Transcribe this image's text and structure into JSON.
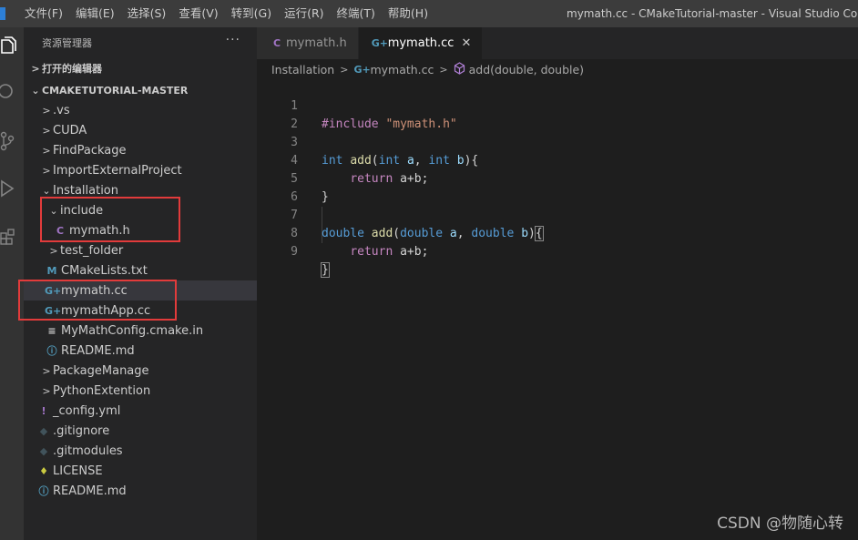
{
  "menu": [
    "文件(F)",
    "编辑(E)",
    "选择(S)",
    "查看(V)",
    "转到(G)",
    "运行(R)",
    "终端(T)",
    "帮助(H)"
  ],
  "window_title": "mymath.cc - CMakeTutorial-master - Visual Studio Code [管",
  "sidebar": {
    "header": "资源管理器",
    "more": "···",
    "open_editors": "打开的编辑器",
    "root": "CMAKETUTORIAL-MASTER",
    "items": [
      {
        "label": ".vs",
        "icon": "chevron-right"
      },
      {
        "label": "CUDA",
        "icon": "chevron-right"
      },
      {
        "label": "FindPackage",
        "icon": "chevron-right"
      },
      {
        "label": "ImportExternalProject",
        "icon": "chevron-right"
      },
      {
        "label": "Installation",
        "icon": "chevron-down"
      },
      {
        "label": "include",
        "icon": "chevron-down"
      },
      {
        "label": "mymath.h",
        "icon": "c-file",
        "glyph": "C"
      },
      {
        "label": "test_folder",
        "icon": "chevron-right"
      },
      {
        "label": "CMakeLists.txt",
        "icon": "cmake-file",
        "glyph": "M"
      },
      {
        "label": "mymath.cc",
        "icon": "cpp-file",
        "glyph": "G+"
      },
      {
        "label": "mymathApp.cc",
        "icon": "cpp-file",
        "glyph": "G+"
      },
      {
        "label": "MyMathConfig.cmake.in",
        "icon": "text-file",
        "glyph": "≡"
      },
      {
        "label": "README.md",
        "icon": "info-file",
        "glyph": "ⓘ"
      },
      {
        "label": "PackageManage",
        "icon": "chevron-right"
      },
      {
        "label": "PythonExtention",
        "icon": "chevron-right"
      },
      {
        "label": "_config.yml",
        "icon": "yml-file",
        "glyph": "!"
      },
      {
        "label": ".gitignore",
        "icon": "git-file",
        "glyph": "◆"
      },
      {
        "label": ".gitmodules",
        "icon": "git-file",
        "glyph": "◆"
      },
      {
        "label": "LICENSE",
        "icon": "license-file",
        "glyph": "♦"
      },
      {
        "label": "README.md",
        "icon": "info-file",
        "glyph": "ⓘ"
      }
    ]
  },
  "tabs": [
    {
      "label": "mymath.h",
      "glyph": "C"
    },
    {
      "label": "mymath.cc",
      "glyph": "G+",
      "close": "✕"
    }
  ],
  "breadcrumb": {
    "folder": "Installation",
    "file": "mymath.cc",
    "symbol": "add(double, double)",
    "sep": ">"
  },
  "code": {
    "line_numbers": [
      "1",
      "2",
      "3",
      "4",
      "5",
      "6",
      "7",
      "8",
      "9"
    ],
    "t_include": "#include",
    "t_header": "\"mymath.h\"",
    "t_int": "int",
    "t_add": "add",
    "t_double": "double",
    "t_return": "return",
    "t_a": "a",
    "t_b": "b",
    "t_open": "(",
    "t_close": ")",
    "t_comma": ", ",
    "t_brace_open": "{",
    "t_brace_close": "}",
    "t_body": "a+b;"
  },
  "watermark": "CSDN @物随心转",
  "colors": {
    "highlight_box": "#e23b3b",
    "accent": "#569cd6"
  }
}
